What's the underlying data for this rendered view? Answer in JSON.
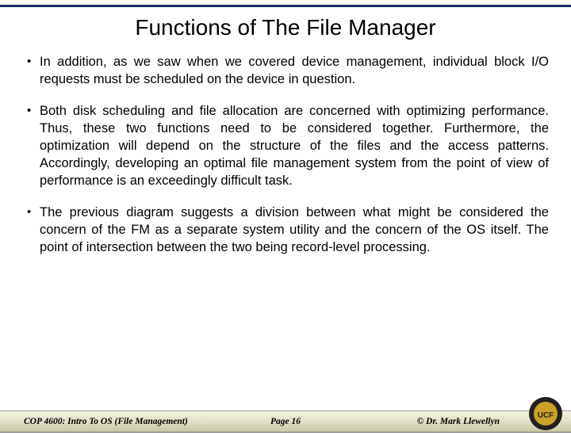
{
  "title": "Functions of The File Manager",
  "bullets": [
    "In addition, as we saw when we covered device management, individual block I/O requests must be scheduled on the device in question.",
    "Both disk scheduling and file allocation are concerned with optimizing performance.  Thus, these two functions need to be considered together.  Furthermore, the optimization will depend on the structure of the files and the access patterns.  Accordingly, developing an optimal file management system from the point of view of performance is an exceedingly difficult task.",
    "The previous diagram suggests a division between what might be considered the concern of the FM as a separate system utility and the concern of the OS itself.  The point of intersection between the two being record-level processing."
  ],
  "footer": {
    "left": "COP 4600: Intro To OS  (File Management)",
    "center": "Page 16",
    "right": "© Dr. Mark Llewellyn"
  }
}
